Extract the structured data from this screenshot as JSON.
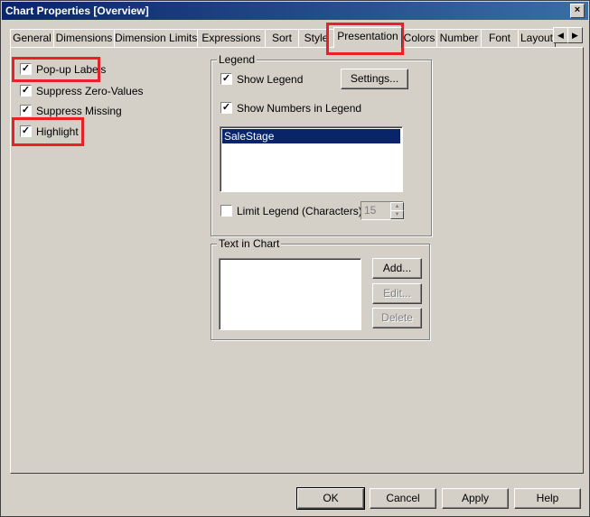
{
  "window": {
    "title": "Chart Properties [Overview]",
    "close_glyph": "×"
  },
  "tabs": [
    {
      "label": "General"
    },
    {
      "label": "Dimensions"
    },
    {
      "label": "Dimension Limits"
    },
    {
      "label": "Expressions"
    },
    {
      "label": "Sort"
    },
    {
      "label": "Style"
    },
    {
      "label": "Presentation",
      "active": true
    },
    {
      "label": "Colors"
    },
    {
      "label": "Number"
    },
    {
      "label": "Font"
    },
    {
      "label": "Layout"
    }
  ],
  "tab_scroll": {
    "left": "◀",
    "right": "▶"
  },
  "left_options": [
    {
      "label": "Pop-up Labels",
      "checked": true
    },
    {
      "label": "Suppress Zero-Values",
      "checked": true
    },
    {
      "label": "Suppress Missing",
      "checked": true
    },
    {
      "label": "Highlight",
      "checked": true
    }
  ],
  "legend": {
    "title": "Legend",
    "show_legend": {
      "label": "Show Legend",
      "checked": true
    },
    "settings_button": "Settings...",
    "show_numbers": {
      "label": "Show Numbers in Legend",
      "checked": true
    },
    "items": [
      "SaleStage"
    ],
    "limit_legend": {
      "label": "Limit Legend (Characters)",
      "checked": false
    },
    "limit_value": "15"
  },
  "text_in_chart": {
    "title": "Text in Chart",
    "add_button": "Add...",
    "edit_button": "Edit...",
    "delete_button": "Delete"
  },
  "footer": {
    "ok": "OK",
    "cancel": "Cancel",
    "apply": "Apply",
    "help": "Help"
  },
  "check_glyph": "✓",
  "colors": {
    "highlight": "#e8202a",
    "title_bar": "#0a246a",
    "selection": "#0a246a"
  }
}
